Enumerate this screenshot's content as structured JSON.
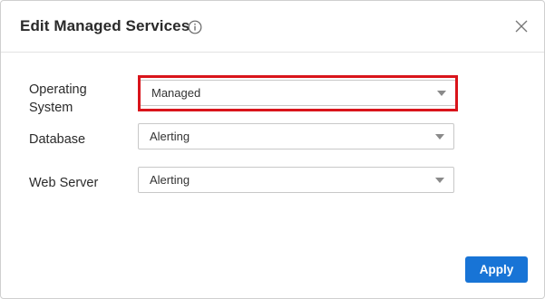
{
  "dialog": {
    "title": "Edit Managed Services",
    "info_icon": "info-icon",
    "close_icon": "close-icon"
  },
  "fields": [
    {
      "label_line1": "Operating",
      "label_line2": "System",
      "value": "Managed"
    },
    {
      "label": "Database",
      "value": "Alerting"
    },
    {
      "label": "Web Server",
      "value": "Alerting"
    }
  ],
  "footer": {
    "apply_label": "Apply"
  },
  "colors": {
    "accent": "#1874d6",
    "highlight": "#d9141b"
  }
}
